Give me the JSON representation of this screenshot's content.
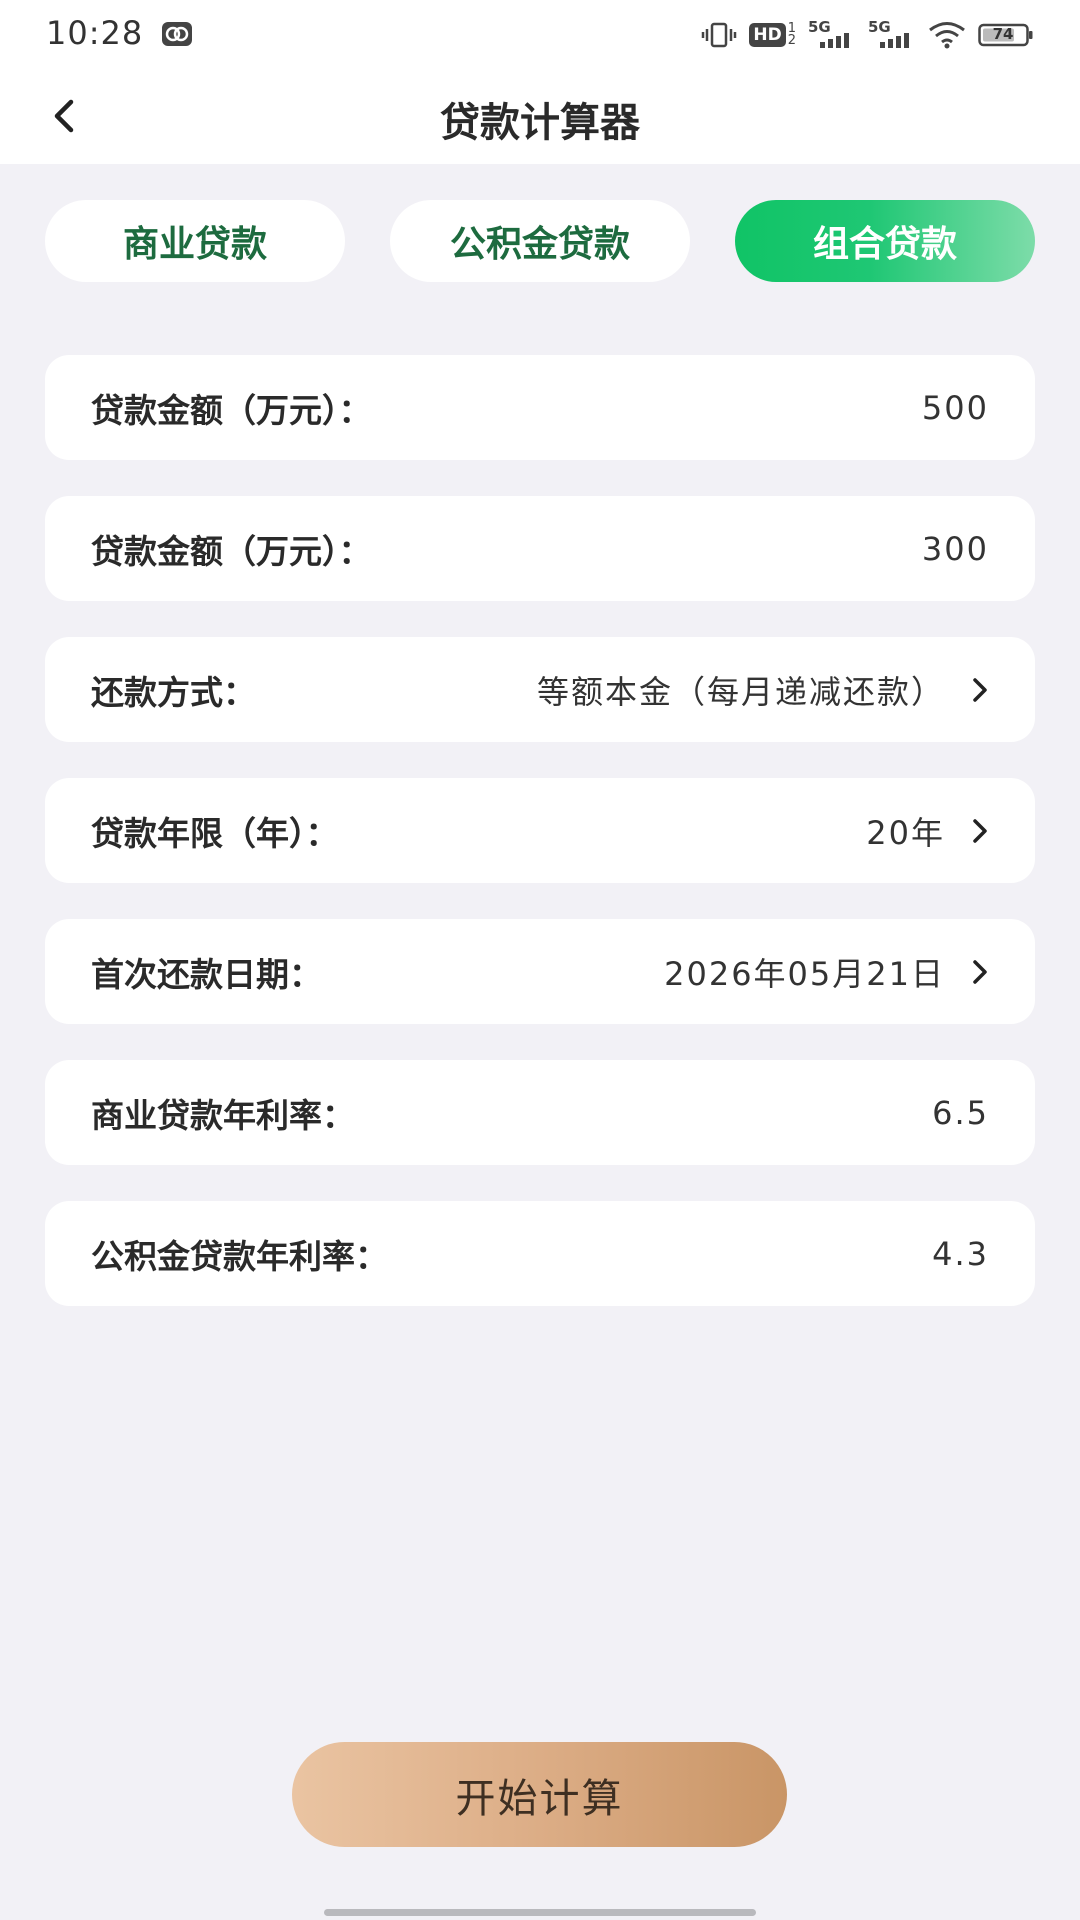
{
  "status_bar": {
    "time": "10:28",
    "battery": "74",
    "network_1": "5G",
    "network_2": "5G",
    "hd_label": "HD"
  },
  "nav": {
    "title": "贷款计算器"
  },
  "tabs": [
    {
      "label": "商业贷款",
      "active": false
    },
    {
      "label": "公积金贷款",
      "active": false
    },
    {
      "label": "组合贷款",
      "active": true
    }
  ],
  "form": {
    "rows": [
      {
        "label": "贷款金额（万元）：",
        "value": "500",
        "has_arrow": false
      },
      {
        "label": "贷款金额（万元）：",
        "value": "300",
        "has_arrow": false
      },
      {
        "label": "还款方式：",
        "value": "等额本金（每月递减还款）",
        "has_arrow": true
      },
      {
        "label": "贷款年限（年）：",
        "value": "20年",
        "has_arrow": true
      },
      {
        "label": "首次还款日期：",
        "value": "2026年05月21日",
        "has_arrow": true
      },
      {
        "label": "商业贷款年利率：",
        "value": "6.5",
        "has_arrow": false
      },
      {
        "label": "公积金贷款年利率：",
        "value": "4.3",
        "has_arrow": false
      }
    ]
  },
  "actions": {
    "calculate_label": "开始计算"
  },
  "colors": {
    "accent_green": "#10c466",
    "tab_text_green": "#1d6b3f",
    "button_gold": "#dcad86",
    "background": "#f2f1f6"
  },
  "icons": {
    "back": "chevron-left-icon",
    "row_arrow": "chevron-right-icon",
    "vibrate": "vibrate-icon",
    "wifi": "wifi-icon",
    "battery": "battery-icon",
    "notification": "app-notification-icon"
  }
}
